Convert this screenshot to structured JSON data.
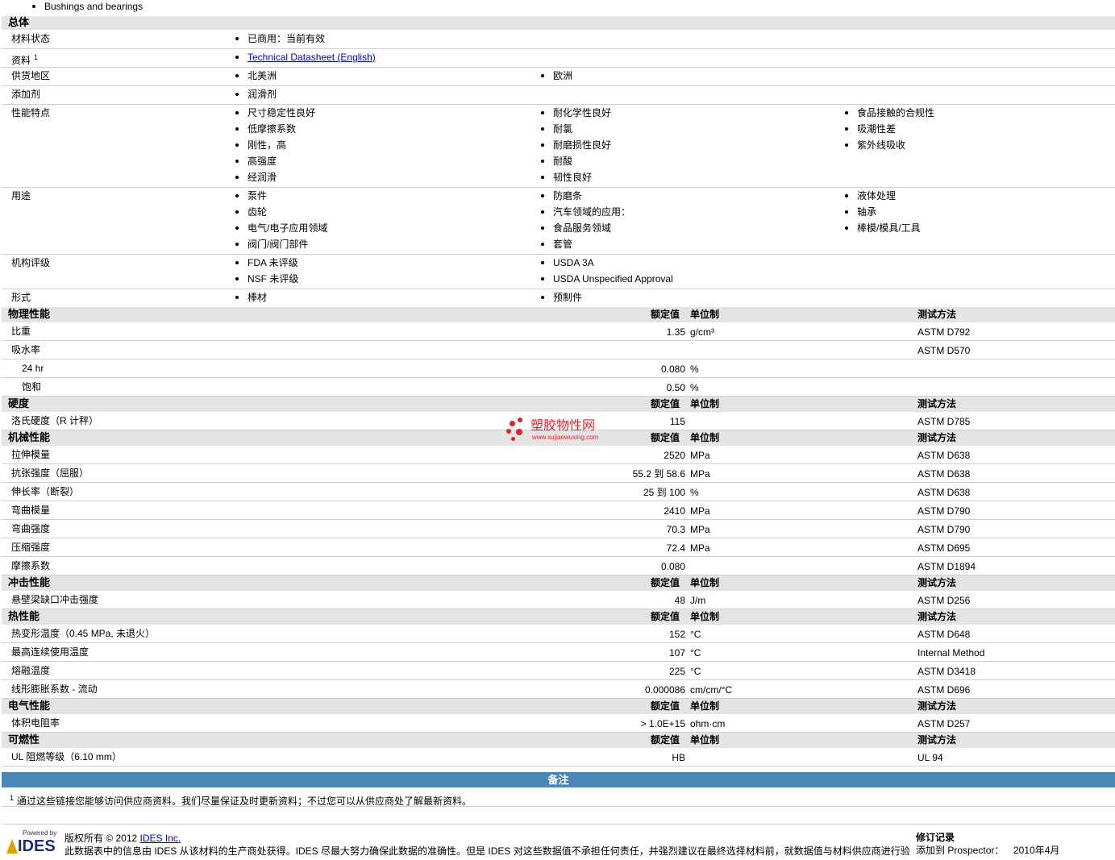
{
  "top_item": "Bushings and bearings",
  "general": {
    "title": "总体",
    "rows": [
      {
        "label": "材料状态",
        "cols": [
          [
            "已商用：当前有效"
          ]
        ]
      },
      {
        "label": "资料",
        "sup": "1",
        "cols": [
          [
            "Technical Datasheet (English)"
          ]
        ],
        "link": true
      },
      {
        "label": "供货地区",
        "cols": [
          [
            "北美洲"
          ],
          [
            "欧洲"
          ]
        ]
      },
      {
        "label": "添加剂",
        "cols": [
          [
            "润滑剂"
          ]
        ]
      },
      {
        "label": "性能特点",
        "cols": [
          [
            "尺寸稳定性良好",
            "低摩擦系数",
            "刚性，高",
            "高强度",
            "经润滑"
          ],
          [
            "耐化学性良好",
            "耐氯",
            "耐磨损性良好",
            "耐酸",
            "韧性良好"
          ],
          [
            "食品接触的合规性",
            "吸潮性差",
            "紫外线吸收"
          ]
        ]
      },
      {
        "label": "用途",
        "cols": [
          [
            "泵件",
            "齿轮",
            "电气/电子应用领域",
            "阀门/阀门部件"
          ],
          [
            "防磨条",
            "汽车领域的应用：",
            "食品服务领域",
            "套管"
          ],
          [
            "液体处理",
            "轴承",
            "棒模/模具/工具"
          ]
        ]
      },
      {
        "label": "机构评级",
        "cols": [
          [
            "FDA 未评级",
            "NSF 未评级"
          ],
          [
            "USDA 3A",
            "USDA Unspecified Approval"
          ]
        ]
      },
      {
        "label": "形式",
        "cols": [
          [
            "棒材"
          ],
          [
            "预制件"
          ]
        ]
      }
    ]
  },
  "col_headers": {
    "nominal": "额定值",
    "unit": "单位制",
    "method": "测试方法"
  },
  "sections": [
    {
      "title": "物理性能",
      "rows": [
        {
          "label": "比重",
          "value": "1.35",
          "unit": "g/cm³",
          "method": "ASTM D792"
        },
        {
          "label": "吸水率",
          "value": "",
          "unit": "",
          "method": "ASTM D570"
        },
        {
          "label": "24 hr",
          "indent": true,
          "value": "0.080",
          "unit": "%",
          "method": ""
        },
        {
          "label": "饱和",
          "indent": true,
          "value": "0.50",
          "unit": "%",
          "method": ""
        }
      ]
    },
    {
      "title": "硬度",
      "rows": [
        {
          "label": "洛氏硬度（R 计秤）",
          "value": "115",
          "unit": "",
          "method": "ASTM D785"
        }
      ]
    },
    {
      "title": "机械性能",
      "rows": [
        {
          "label": "拉伸模量",
          "value": "2520",
          "unit": "MPa",
          "method": "ASTM D638"
        },
        {
          "label": "抗张强度（屈服）",
          "value": "55.2 到  58.6",
          "unit": "MPa",
          "method": "ASTM D638"
        },
        {
          "label": "伸长率（断裂）",
          "value": "25 到  100",
          "unit": "%",
          "method": "ASTM D638"
        },
        {
          "label": "弯曲模量",
          "value": "2410",
          "unit": "MPa",
          "method": "ASTM D790"
        },
        {
          "label": "弯曲强度",
          "value": "70.3",
          "unit": "MPa",
          "method": "ASTM D790"
        },
        {
          "label": "压缩强度",
          "value": "72.4",
          "unit": "MPa",
          "method": "ASTM D695"
        },
        {
          "label": "摩擦系数",
          "value": "0.080",
          "unit": "",
          "method": "ASTM D1894"
        }
      ]
    },
    {
      "title": "冲击性能",
      "rows": [
        {
          "label": "悬壁梁缺口冲击强度",
          "value": "48",
          "unit": "J/m",
          "method": "ASTM D256"
        }
      ]
    },
    {
      "title": "热性能",
      "rows": [
        {
          "label": "热变形温度（0.45 MPa, 未退火）",
          "value": "152",
          "unit": "°C",
          "method": "ASTM D648"
        },
        {
          "label": "最高连续使用温度",
          "value": "107",
          "unit": "°C",
          "method": "Internal Method"
        },
        {
          "label": "熔融温度",
          "value": "225",
          "unit": "°C",
          "method": "ASTM D3418"
        },
        {
          "label": "线形膨胀系数 - 流动",
          "value": "0.000086",
          "unit": "cm/cm/°C",
          "method": "ASTM D696"
        }
      ]
    },
    {
      "title": "电气性能",
      "rows": [
        {
          "label": "体积电阻率",
          "value": "> 1.0E+15",
          "unit": "ohm·cm",
          "method": "ASTM D257"
        }
      ]
    },
    {
      "title": "可燃性",
      "rows": [
        {
          "label": "UL 阻燃等级（6.10 mm）",
          "value": "HB",
          "unit": "",
          "method": "UL 94"
        }
      ]
    }
  ],
  "notes": {
    "title": "备注",
    "sup": "1",
    "text": "通过这些链接您能够访问供应商资料。我们尽量保证及时更新资料；不过您可以从供应商处了解最新资料。"
  },
  "footer": {
    "logo_small": "Powered by",
    "logo_big": "IDES",
    "copyright": "版权所有 © 2012 ",
    "company_link": "IDES Inc.",
    "disclaimer": "此数据表中的信息由 IDES 从该材料的生产商处获得。IDES 尽最大努力确保此数据的准确性。但是 IDES 对这些数据值不承担任何责任，并强烈建议在最终选择材料前，就数据值与材料供应商进行验",
    "revision_title": "修订记录",
    "revision_label": "添加到 Prospector：",
    "revision_date": "2010年4月"
  },
  "watermark": {
    "name": "塑胶物性网",
    "url": "www.sujiaowuxing.com",
    "color": "#e0232a"
  }
}
